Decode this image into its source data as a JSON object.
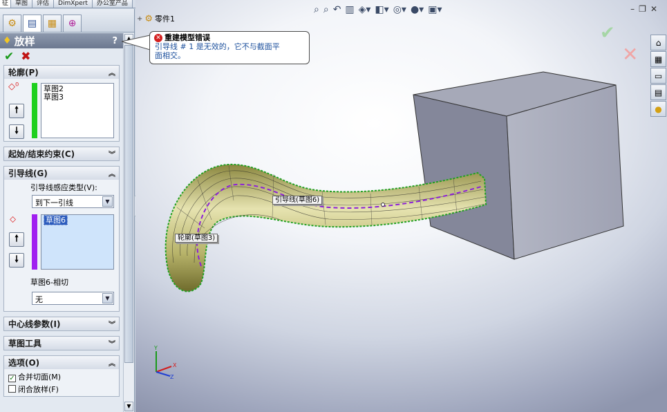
{
  "top_tabs": [
    "征",
    "草图",
    "评估",
    "DimXpert",
    "办公室产品"
  ],
  "property_manager": {
    "title": "放样",
    "help": "?",
    "groups": {
      "profiles": {
        "header": "轮廓(P)",
        "items": [
          "草图2",
          "草图3"
        ],
        "color": "#1ed01e"
      },
      "start_end": {
        "header": "起始/结束约束(C)"
      },
      "guides": {
        "header": "引导线(G)",
        "influence_label": "引导线感应类型(V):",
        "influence_value": "到下一引线",
        "items": [
          "草图6"
        ],
        "color": "#a020f0",
        "tangent_label": "草图6-相切",
        "tangent_value": "无"
      },
      "centerline": {
        "header": "中心线参数(I)"
      },
      "sketch_tools": {
        "header": "草图工具"
      },
      "options": {
        "header": "选项(O)",
        "merge_faces": "合并切面(M)",
        "close_loft": "闭合放样(F)"
      }
    }
  },
  "tree": {
    "root": "零件1"
  },
  "error": {
    "title": "重建模型错误",
    "message_line1": "引导线 # 1 是无效的，它不与截面平",
    "message_line2": "面相交。"
  },
  "viewport_tags": {
    "guide": "引导线(草图6)",
    "profile": "轮廓(草图3)"
  },
  "triad": {
    "x": "X",
    "y": "Y",
    "z": "Z"
  },
  "colors": {
    "accent_blue": "#2b5bbd",
    "error_red": "#d42020",
    "loft_body": "#c9c48a"
  }
}
